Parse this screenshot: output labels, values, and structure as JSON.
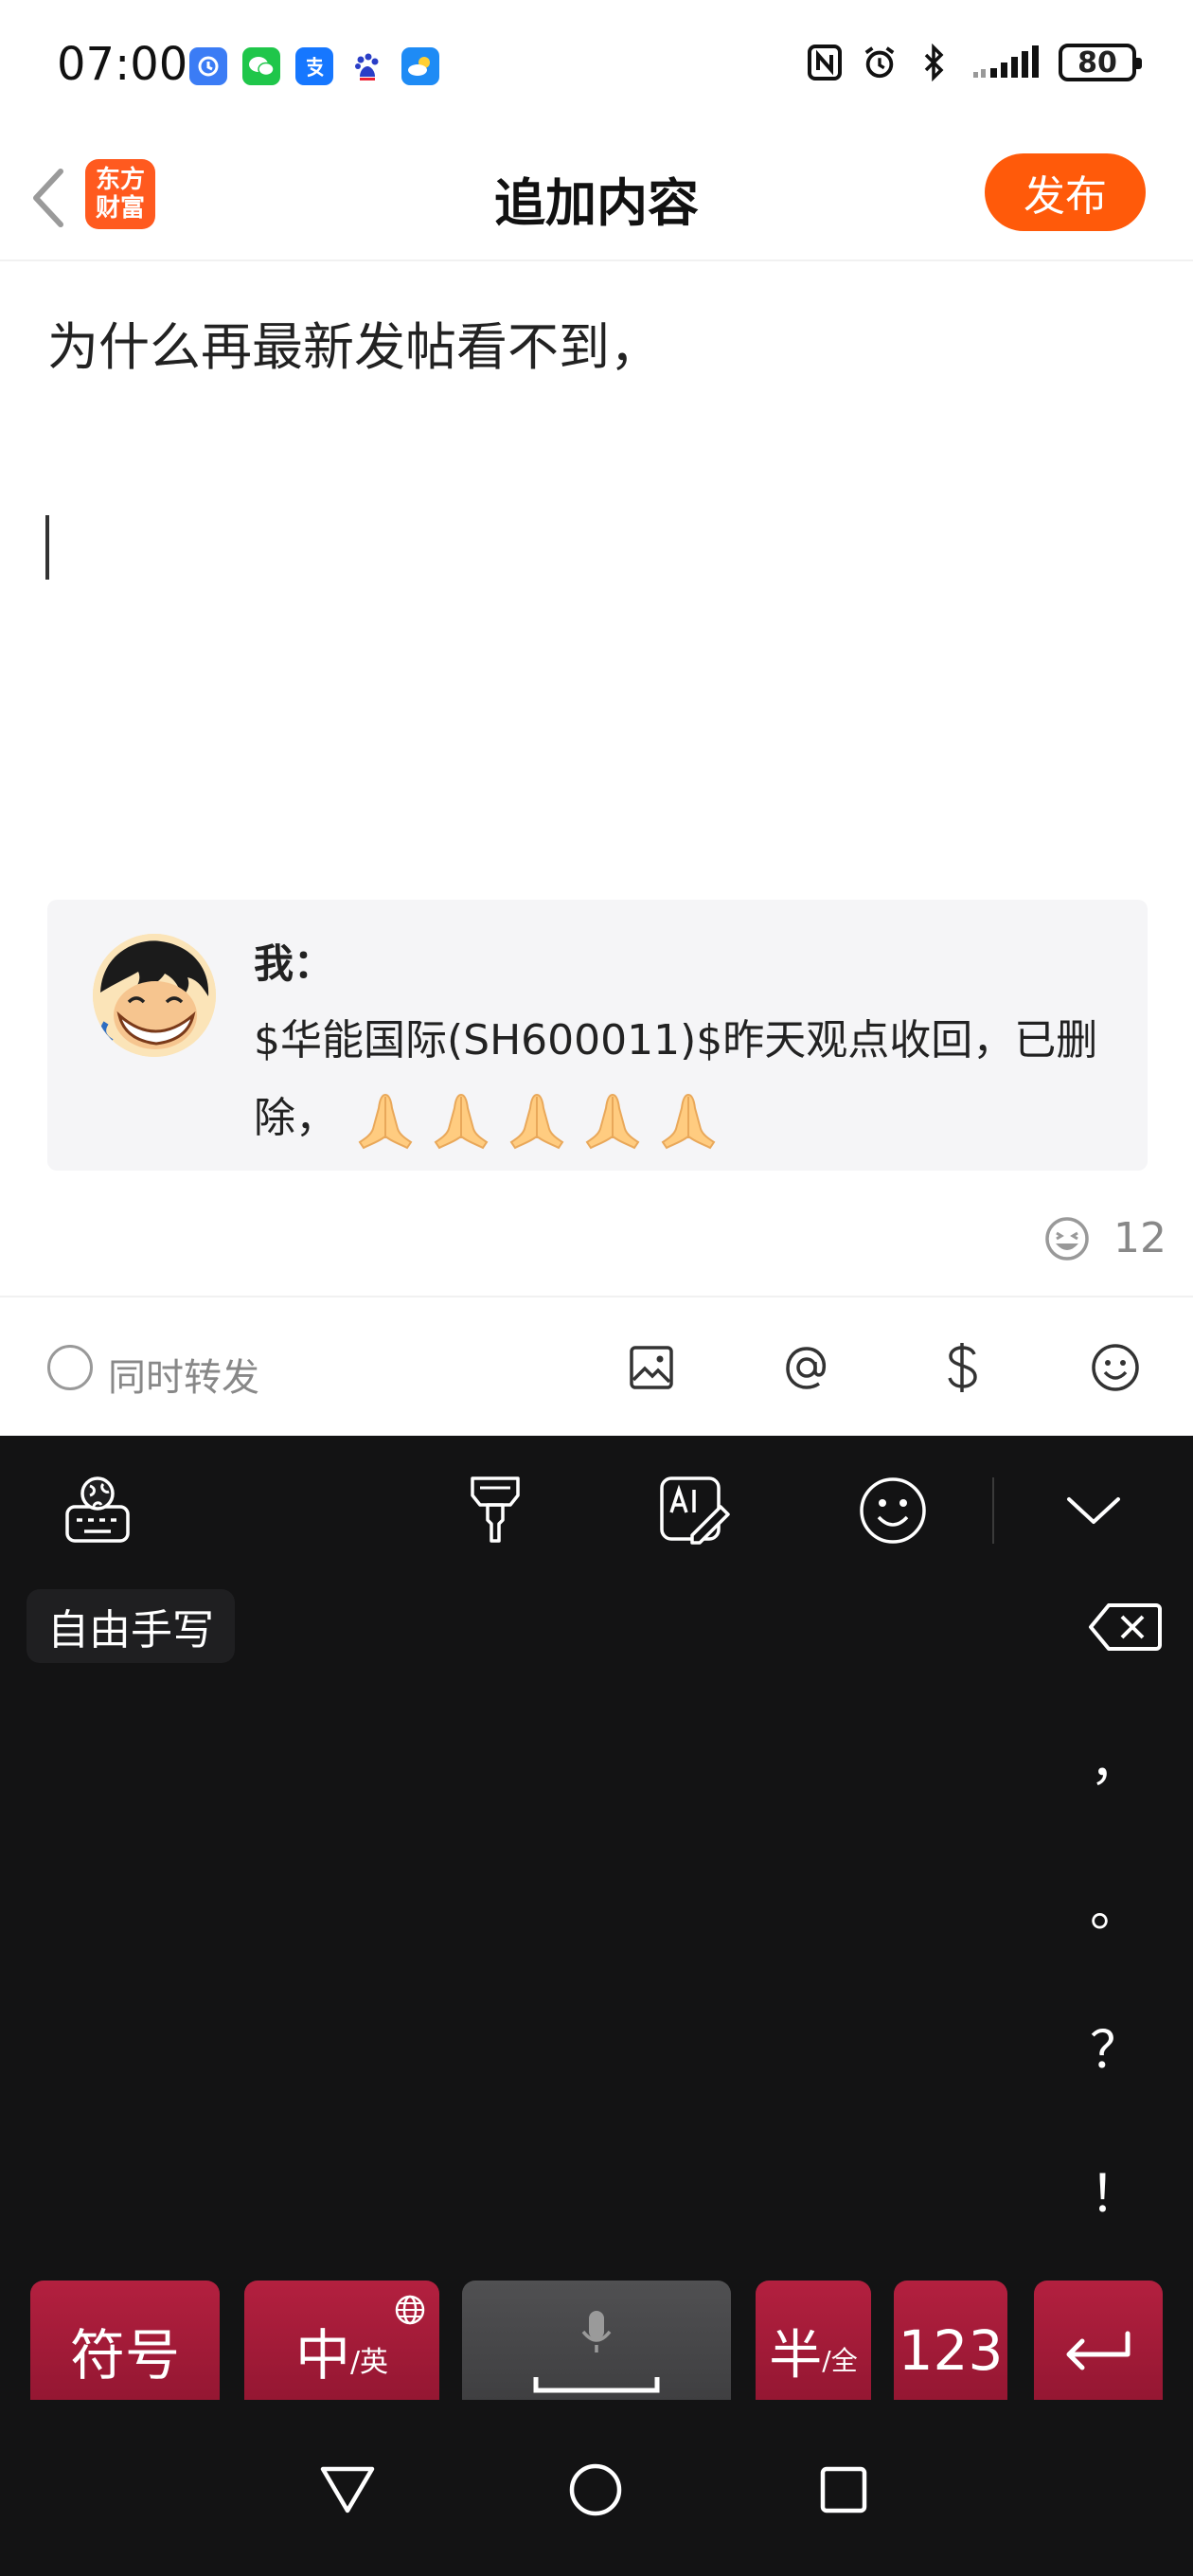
{
  "status_bar": {
    "time": "07:00",
    "battery": "80",
    "notification_icons": [
      "clock-app-icon",
      "wechat-icon",
      "alipay-icon",
      "baidu-icon",
      "weather-icon"
    ],
    "system_icons": [
      "nfc-icon",
      "alarm-icon",
      "bluetooth-icon",
      "signal-icon"
    ]
  },
  "header": {
    "logo_line1": "东方",
    "logo_line2": "财富",
    "title": "追加内容",
    "publish_label": "发布"
  },
  "editor": {
    "text": "为什么再最新发帖看不到，"
  },
  "quote": {
    "author": "我：",
    "text": "$华能国际(SH600011)$昨天观点收回，已删除，",
    "emojis": [
      "folded-hands",
      "folded-hands",
      "folded-hands",
      "folded-hands",
      "folded-hands"
    ]
  },
  "counter": {
    "value": "12"
  },
  "action_bar": {
    "forward_label": "同时转发",
    "icons": [
      "image-icon",
      "at-icon",
      "dollar-icon",
      "emoji-icon"
    ]
  },
  "keyboard": {
    "handwriting_label": "自由手写",
    "punctuation": [
      "，",
      "。",
      "？",
      "！"
    ],
    "keys": {
      "symbols": "符号",
      "lang_main": "中",
      "lang_sub": "/英",
      "half_main": "半",
      "half_sub": "/全",
      "numbers": "123"
    }
  },
  "colors": {
    "accent": "#ff5a0a",
    "keyboard_bg": "#131314",
    "key_red": "#a51a38"
  }
}
